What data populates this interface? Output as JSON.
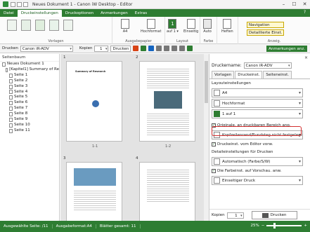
{
  "window": {
    "title": "Neues Dokument 1 - Canon iW Desktop - Editor",
    "controls": [
      "–",
      "☐",
      "✕"
    ]
  },
  "menu": {
    "tabs": [
      "Datei",
      "Druckeinstellungen",
      "Druckoptionen",
      "Anmerkungen",
      "Extras"
    ],
    "active_index": 1,
    "help": "?"
  },
  "ribbon": {
    "groups": [
      {
        "label": "Vorlagen"
      },
      {
        "label": "Ausgabepapier"
      },
      {
        "label": "Layout"
      },
      {
        "label": "Farbe"
      },
      {
        "label": "Anzeig."
      }
    ],
    "buttons": {
      "paper": "A4",
      "orientation": "Hochformat",
      "pages": "1",
      "pages_sub": "auf 1 ▾",
      "sided": "Einseitig",
      "color": "Auto",
      "heften": "Heften",
      "navigation": "Navigation",
      "detail": "Detaillierte Einst."
    }
  },
  "toolbar": {
    "printer_label": "Drucken",
    "printer_value": "Canon iR-ADV",
    "copies_label": "Kopien",
    "copies_value": "1",
    "print_button": "Drucken",
    "annotations_button": "Anmerkungen anz."
  },
  "left_pane": {
    "title": "Seitenbaum",
    "tree": [
      {
        "label": "Neues Dokument 1",
        "level": 0
      },
      {
        "label": "[Kapitel1] Summary of Re",
        "level": 1
      },
      {
        "label": "Seite 1",
        "level": 2
      },
      {
        "label": "Seite 2",
        "level": 2
      },
      {
        "label": "Seite 3",
        "level": 2
      },
      {
        "label": "Seite 4",
        "level": 2
      },
      {
        "label": "Seite 5",
        "level": 2
      },
      {
        "label": "Seite 6",
        "level": 2
      },
      {
        "label": "Seite 7",
        "level": 2
      },
      {
        "label": "Seite 8",
        "level": 2
      },
      {
        "label": "Seite 9",
        "level": 2
      },
      {
        "label": "Seite 10",
        "level": 2
      },
      {
        "label": "Seite 11",
        "level": 2
      }
    ]
  },
  "center": {
    "pages": [
      {
        "num": "1",
        "caption": "1-1",
        "title": "Summary of Research"
      },
      {
        "num": "2",
        "caption": "1-2"
      },
      {
        "num": "3",
        "caption": ""
      },
      {
        "num": "4",
        "caption": ""
      }
    ]
  },
  "right_pane": {
    "printer_label": "Druckername:",
    "printer_value": "Canon iR-ADV",
    "tabs": [
      "Vorlagen",
      "Druckeinst.",
      "Seiteneinst."
    ],
    "active_tab": 1,
    "layout_section": "Layouteinstellungen",
    "paper": "A4",
    "orientation": "Hochformat",
    "nup": "1 auf 1",
    "check_original": "Originale, an druckbaren Bereich anp.",
    "margin_combo": "Kopfzeilenrand/Bundsteg nicht festgelegt",
    "check_preview": "Druckeinst. vom Editor vorw.",
    "detail_section": "Detaileinstellungen für Drucken",
    "color_mode": "Automatisch (Farbe/S/W)",
    "check_cover": "Die Farbeinst. auf Vorschau. anw.",
    "duplex": "Einseitiger Druck",
    "copies_label": "Kopien",
    "copies_value": "1",
    "print_button": "Drucken",
    "close_icon": "×"
  },
  "status": {
    "page": "Ausgewählte Seite: /11",
    "format": "Ausgabeformat:A4",
    "sheets": "Blätter gesamt: 11",
    "zoom": "25%"
  },
  "colors": {
    "accent": "#2e7d32",
    "highlight": "#d32f2f"
  }
}
